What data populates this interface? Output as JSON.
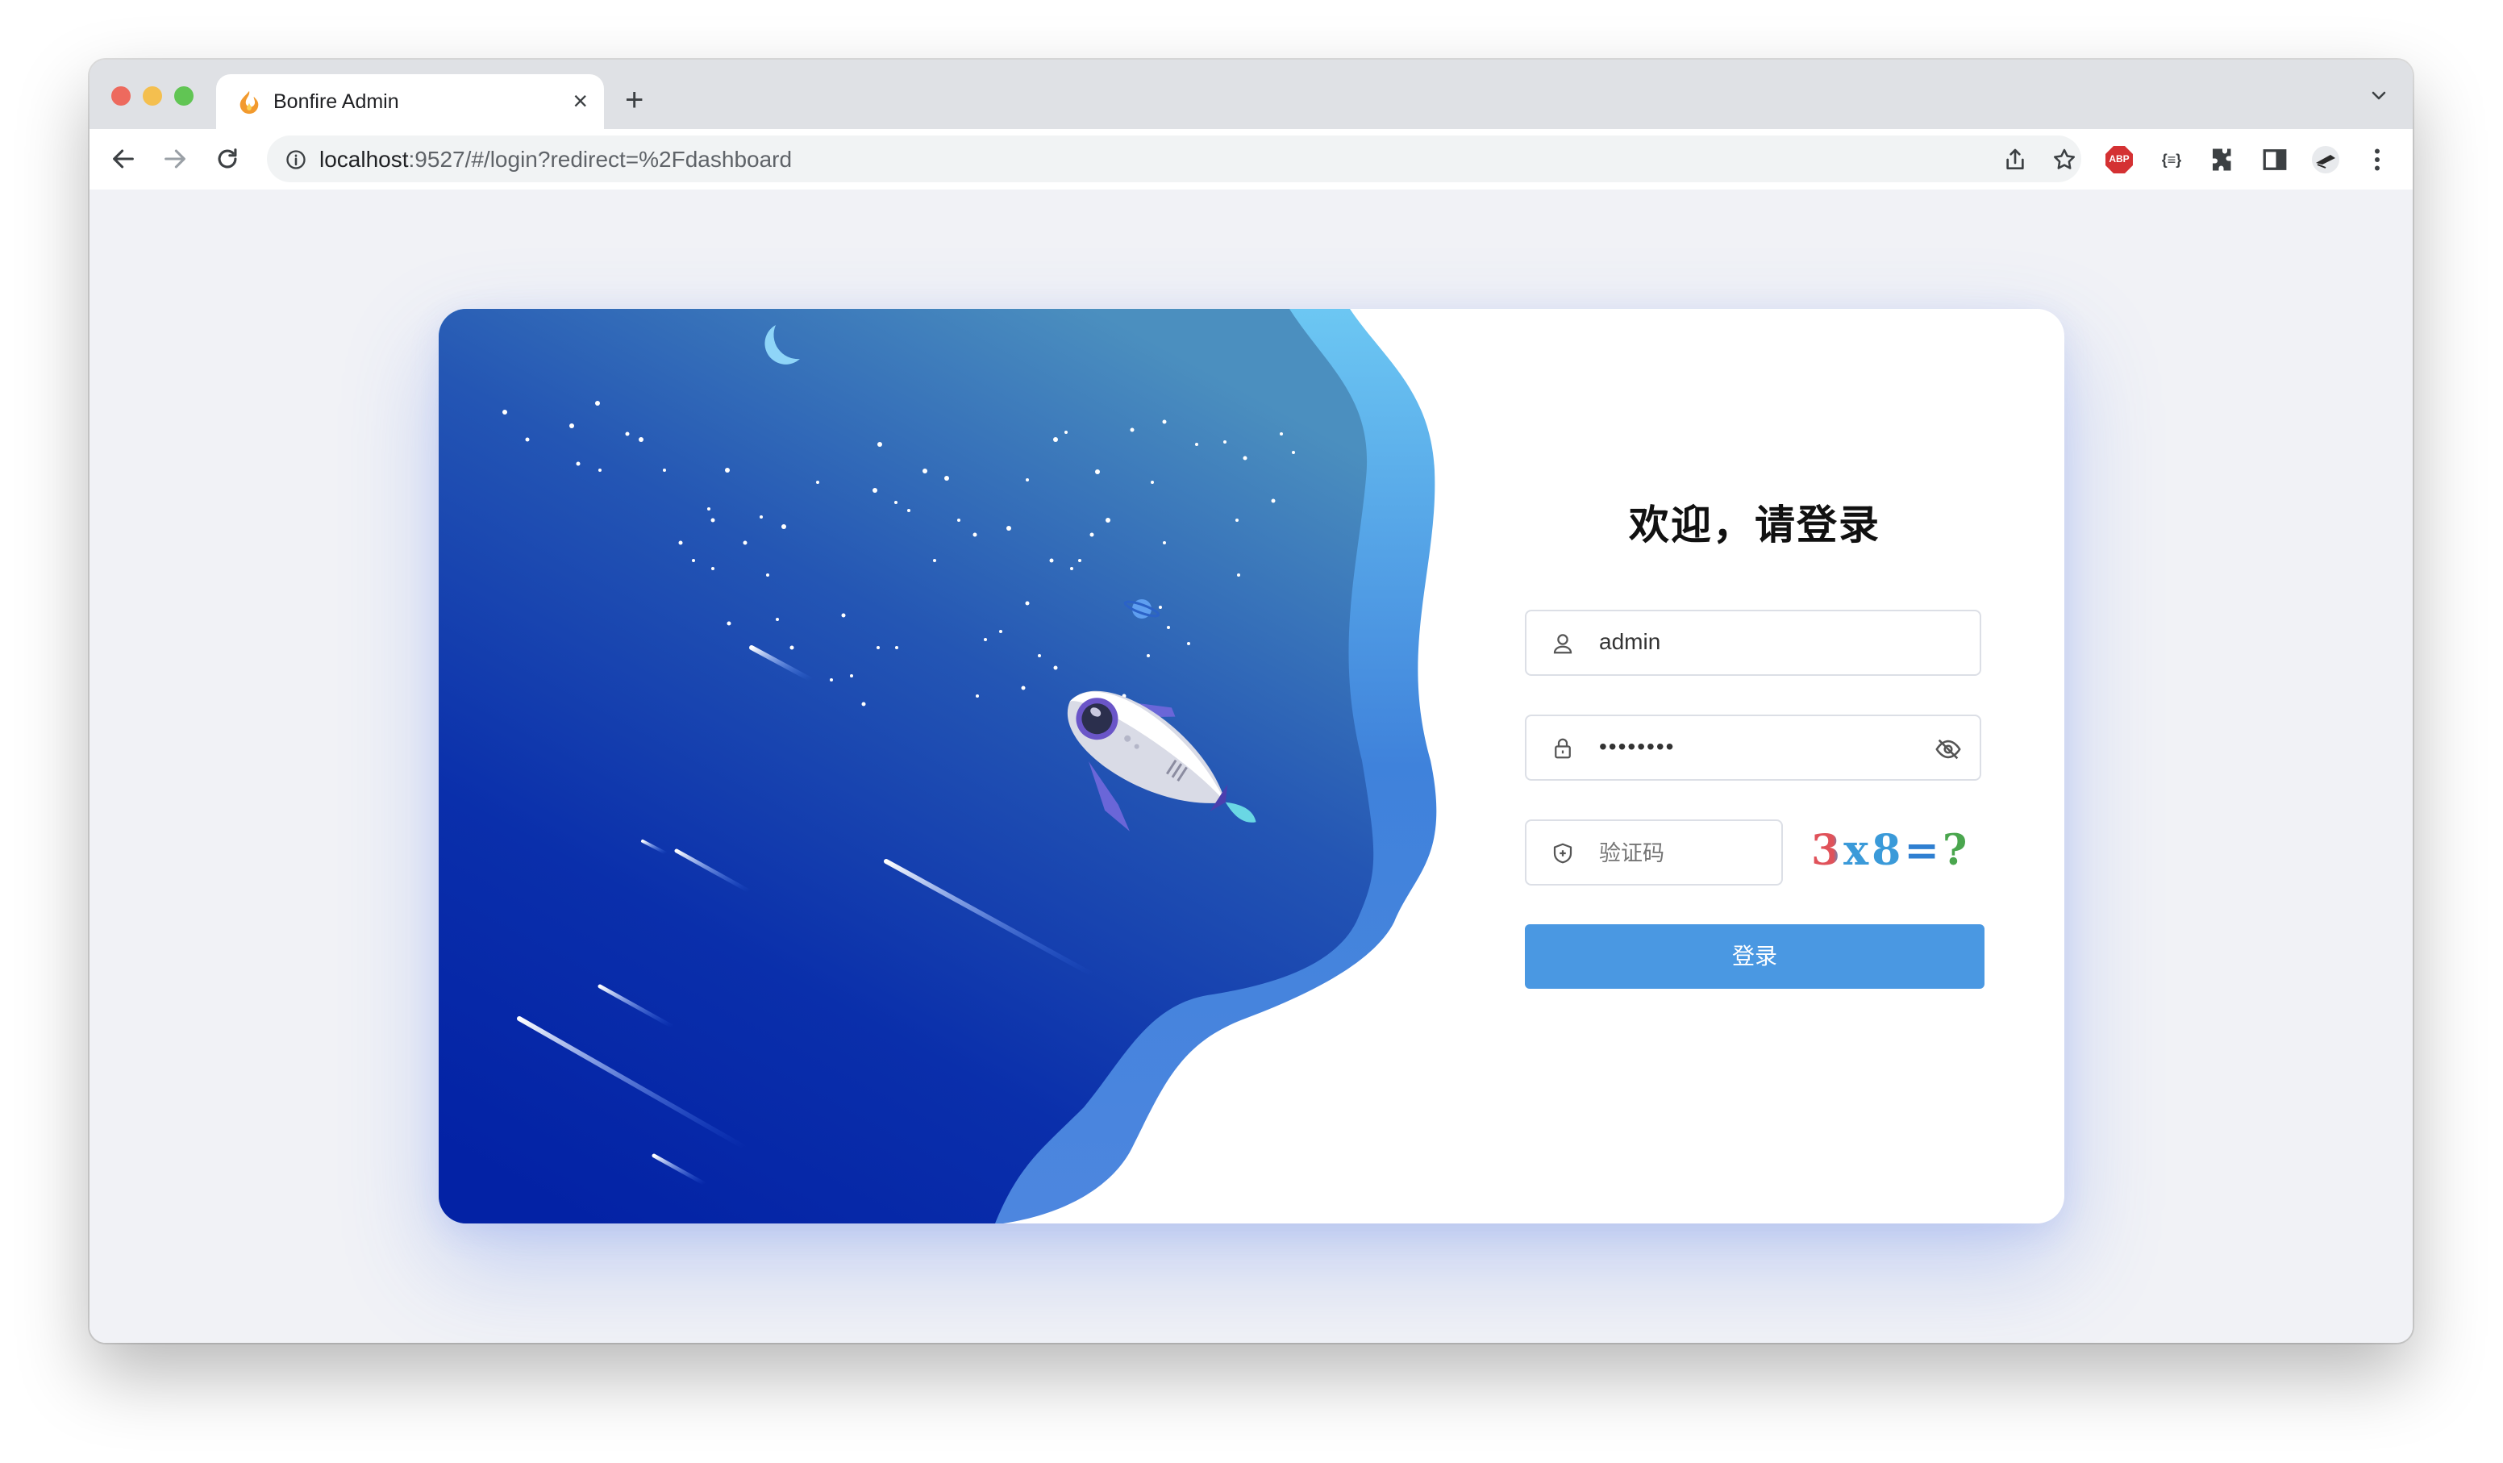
{
  "browser": {
    "tab_title": "Bonfire Admin",
    "tab_close_glyph": "×",
    "new_tab_glyph": "+",
    "url_host": "localhost",
    "url_rest": ":9527/#/login?redirect=%2Fdashboard",
    "extensions": [
      "share-icon",
      "bookmark-star-icon",
      "adblock-plus-icon",
      "json-viewer-icon",
      "extensions-puzzle-icon",
      "side-panel-icon",
      "profile-icon",
      "menu-kebab-icon"
    ],
    "adblock_label": "ABP",
    "json_label": "{≡}"
  },
  "login": {
    "title": "欢迎，请登录",
    "username_value": "admin",
    "password_value": "••••••••",
    "captcha_placeholder": "验证码",
    "captcha_text": "3x8=?",
    "submit_label": "登录"
  },
  "colors": {
    "primary": "#4a98e2",
    "bg": "#f1f2f6",
    "art_dark": "#0a27a8",
    "art_light": "#4a8fc4"
  }
}
